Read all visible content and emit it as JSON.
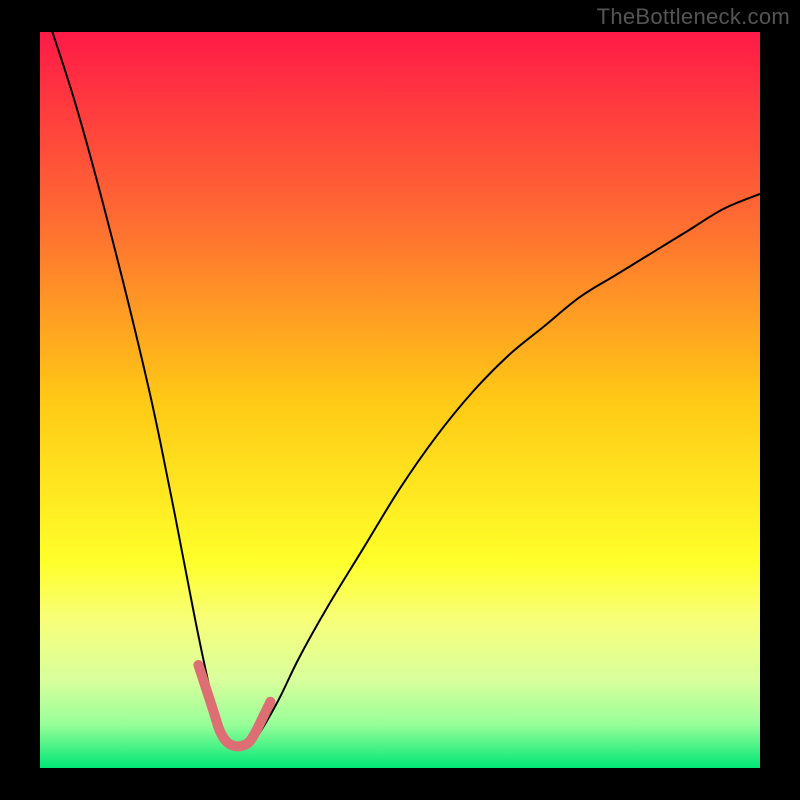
{
  "watermark": "TheBottleneck.com",
  "chart_data": {
    "type": "line",
    "title": "",
    "xlabel": "",
    "ylabel": "",
    "xlim": [
      0,
      100
    ],
    "ylim": [
      0,
      100
    ],
    "grid": false,
    "legend": false,
    "background_gradient_stops": [
      {
        "offset": 0.0,
        "color": "#ff1a47"
      },
      {
        "offset": 0.25,
        "color": "#ff6a33"
      },
      {
        "offset": 0.5,
        "color": "#ffc915"
      },
      {
        "offset": 0.72,
        "color": "#ffff2a"
      },
      {
        "offset": 0.8,
        "color": "#f7ff7a"
      },
      {
        "offset": 0.88,
        "color": "#d9ff9c"
      },
      {
        "offset": 0.94,
        "color": "#99ff99"
      },
      {
        "offset": 1.0,
        "color": "#00e676"
      }
    ],
    "series": [
      {
        "name": "bottleneck-curve",
        "stroke": "#000000",
        "stroke_width": 2,
        "x": [
          0,
          5,
          10,
          15,
          18,
          20,
          22,
          24,
          25,
          26,
          27,
          28,
          29,
          30,
          33,
          36,
          40,
          45,
          50,
          55,
          60,
          65,
          70,
          75,
          80,
          85,
          90,
          95,
          100
        ],
        "values": [
          105,
          90,
          72,
          52,
          38,
          28,
          18,
          9,
          6,
          4,
          3,
          2.5,
          3,
          4,
          9,
          15,
          22,
          30,
          38,
          45,
          51,
          56,
          60,
          64,
          67,
          70,
          73,
          76,
          78
        ]
      },
      {
        "name": "highlight-zone",
        "stroke": "#dd6f74",
        "stroke_width": 10,
        "linecap": "round",
        "x": [
          22,
          24,
          25,
          26,
          27,
          28,
          29,
          30,
          32
        ],
        "values": [
          14,
          8,
          5,
          3.5,
          3,
          3,
          3.5,
          5,
          9
        ]
      }
    ]
  }
}
